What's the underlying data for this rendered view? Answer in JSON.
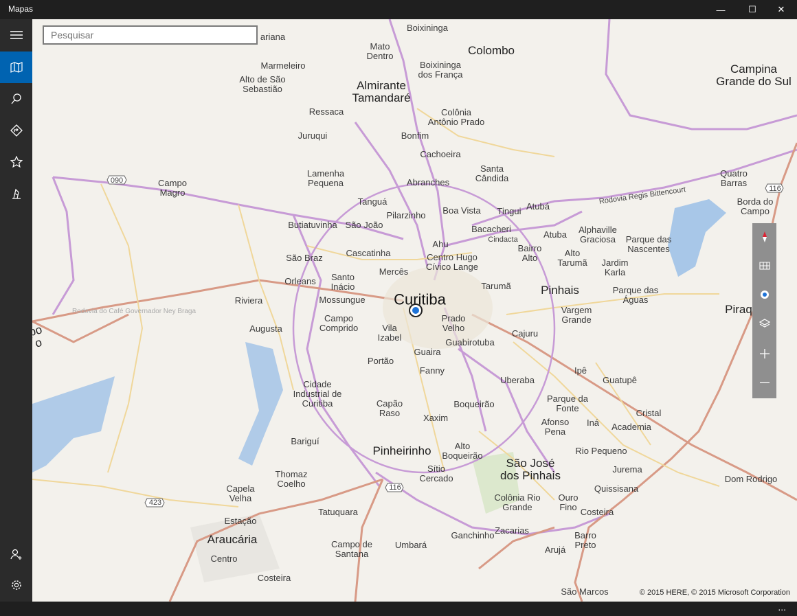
{
  "window": {
    "title": "Mapas",
    "minimize": "—",
    "maximize": "☐",
    "close": "✕"
  },
  "sidebar": {
    "items": [
      {
        "name": "menu-icon"
      },
      {
        "name": "map-icon"
      },
      {
        "name": "search-icon"
      },
      {
        "name": "directions-icon"
      },
      {
        "name": "favorites-icon"
      },
      {
        "name": "landmarks-icon"
      },
      {
        "name": "account-icon"
      },
      {
        "name": "settings-icon"
      }
    ]
  },
  "search": {
    "placeholder": "Pesquisar"
  },
  "map": {
    "labels": [
      {
        "text": "Boixininga"
      },
      {
        "text": "Colombo"
      },
      {
        "text": "Campina\nGrande do Sul"
      },
      {
        "text": "Mato\nDentro"
      },
      {
        "text": "Boixininga\ndos França"
      },
      {
        "text": "Marmeleiro"
      },
      {
        "text": "Alto de São\nSebastião"
      },
      {
        "text": "Almirante\nTamandaré"
      },
      {
        "text": "Ressaca"
      },
      {
        "text": "Colônia\nAntônio Prado"
      },
      {
        "text": "Juruqui"
      },
      {
        "text": "Bonfim"
      },
      {
        "text": "Cachoeira"
      },
      {
        "text": "Lamenha\nPequena"
      },
      {
        "text": "Santa\nCândida"
      },
      {
        "text": "Abranches"
      },
      {
        "text": "Campo\nMagro"
      },
      {
        "text": "Quatro\nBarras"
      },
      {
        "text": "Borda do\nCampo"
      },
      {
        "text": "Tanguá"
      },
      {
        "text": "Boa Vista"
      },
      {
        "text": "Tingui"
      },
      {
        "text": "Atubá"
      },
      {
        "text": "Butiatuvinha"
      },
      {
        "text": "São João"
      },
      {
        "text": "Pilarzinho"
      },
      {
        "text": "Bacacheri"
      },
      {
        "text": "Atuba"
      },
      {
        "text": "Alphaville\nGraciosa"
      },
      {
        "text": "Parque das\nNascentes"
      },
      {
        "text": "Ahu"
      },
      {
        "text": "Cascatinha"
      },
      {
        "text": "São Braz"
      },
      {
        "text": "Centro Hugo\nCívico Lange"
      },
      {
        "text": "Bairro\nAlto"
      },
      {
        "text": "Alto\nTarumã"
      },
      {
        "text": "Jardim\nKarla"
      },
      {
        "text": "Mercês"
      },
      {
        "text": "Orleans"
      },
      {
        "text": "Santo\nInácio"
      },
      {
        "text": "Tarumã"
      },
      {
        "text": "Pinhais"
      },
      {
        "text": "Parque das\nÁguas"
      },
      {
        "text": "Riviera"
      },
      {
        "text": "Mossungue"
      },
      {
        "text": "Curitiba"
      },
      {
        "text": "Piraquara"
      },
      {
        "text": "Campo\nComprido"
      },
      {
        "text": "Vila\nIzabel"
      },
      {
        "text": "Prado\nVelho"
      },
      {
        "text": "Vargem\nGrande"
      },
      {
        "text": "Augusta"
      },
      {
        "text": "Cajuru"
      },
      {
        "text": "Guabirotuba"
      },
      {
        "text": "Guaira"
      },
      {
        "text": "Portão"
      },
      {
        "text": "Fanny"
      },
      {
        "text": "Ipê"
      },
      {
        "text": "Guatupê"
      },
      {
        "text": "Uberaba"
      },
      {
        "text": "Cidade\nIndustrial de\nCuritiba"
      },
      {
        "text": "Capão\nRaso"
      },
      {
        "text": "Boqueirão"
      },
      {
        "text": "Parque da\nFonte"
      },
      {
        "text": "Xaxim"
      },
      {
        "text": "Afonso\nPena"
      },
      {
        "text": "Iná"
      },
      {
        "text": "Cristal"
      },
      {
        "text": "Academia"
      },
      {
        "text": "Bariguí"
      },
      {
        "text": "Alto\nBoqueirão"
      },
      {
        "text": "Pinheirinho"
      },
      {
        "text": "São José\ndos Pinhais"
      },
      {
        "text": "Rio Pequeno"
      },
      {
        "text": "Sítio\nCercado"
      },
      {
        "text": "Jurema"
      },
      {
        "text": "Thomaz\nCoelho"
      },
      {
        "text": "Dom Rodrigo"
      },
      {
        "text": "Capela\nVelha"
      },
      {
        "text": "Quissisana"
      },
      {
        "text": "Colônia Rio\nGrande"
      },
      {
        "text": "Ouro\nFino"
      },
      {
        "text": "Tatuquara"
      },
      {
        "text": "Costeira"
      },
      {
        "text": "Estação"
      },
      {
        "text": "Zacarias"
      },
      {
        "text": "Ganchinho"
      },
      {
        "text": "Barro\nPreto"
      },
      {
        "text": "Araucária"
      },
      {
        "text": "Campo de\nSantana"
      },
      {
        "text": "Umbará"
      },
      {
        "text": "Arujá"
      },
      {
        "text": "Centro"
      },
      {
        "text": "Costeira"
      },
      {
        "text": "São Marcos"
      },
      {
        "text": "ariana"
      },
      {
        "text": "po\no"
      },
      {
        "text": "Rodovia Regis Bittencourt"
      },
      {
        "text": "Rodovia do Café Governador Ney Braga"
      },
      {
        "text": "Cindacta"
      }
    ],
    "shields": [
      "090",
      "116",
      "116",
      "423"
    ]
  },
  "map_controls": {
    "items": [
      {
        "name": "compass-icon"
      },
      {
        "name": "streetside-icon"
      },
      {
        "name": "my-location-icon"
      },
      {
        "name": "layers-icon"
      },
      {
        "name": "zoom-in-icon"
      },
      {
        "name": "zoom-out-icon"
      }
    ]
  },
  "copyright": "© 2015 HERE, © 2015 Microsoft Corporation",
  "status": {
    "more": "..."
  }
}
